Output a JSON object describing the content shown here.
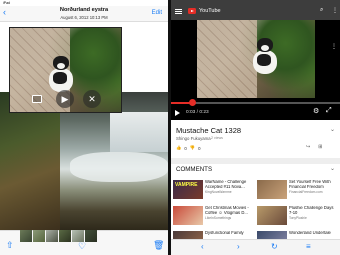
{
  "left": {
    "status": {
      "device": "iPad"
    },
    "navbar": {
      "back_icon": "chevron-left-icon",
      "title": "Norðurland eystra",
      "subtitle": "August 6, 2012  10:13 PM",
      "edit_label": "Edit"
    },
    "pip_controls": {
      "play_icon": "play-icon",
      "close_icon": "close-icon",
      "pip_icon": "picture-in-picture-icon"
    },
    "toolbar": {
      "share_icon": "share-icon",
      "heart_icon": "heart-icon",
      "trash_icon": "trash-icon"
    }
  },
  "right": {
    "app_title": "YouTube",
    "header_icons": [
      "menu-icon",
      "youtube-logo-icon",
      "search-icon",
      "more-vert-icon"
    ],
    "player": {
      "time": "0:03 / 0:23",
      "progress": 0.13
    },
    "video": {
      "title": "Mustache Cat 1328",
      "channel": "Shingo Fukuyama",
      "views": "2 views",
      "likes": "0",
      "dislikes": "0"
    },
    "comments_label": "COMMENTS",
    "related": [
      {
        "title": "WarName - Challenge",
        "line2": "Accepted #11 Nova...",
        "sub": "KingNovaWarnme",
        "thumb_text": "VAMPIRE"
      },
      {
        "title": "Set Yourself Free With",
        "line2": "Financial Freedom",
        "sub": "FinancialFreedom.com",
        "thumb_text": ""
      },
      {
        "title": "Get Christmas Movies -",
        "line2": "Coffee ☺ Vlogmas D...",
        "sub": "LikeInSomethings",
        "thumb_text": ""
      },
      {
        "title": "Plushie Challenge Days",
        "line2": "7-10",
        "sub": "TonyPlushie",
        "thumb_text": ""
      },
      {
        "title": "Dysfunctional Family",
        "line2": "",
        "sub": "",
        "thumb_text": ""
      },
      {
        "title": "Wonderland Undertale",
        "line2": "",
        "sub": "",
        "thumb_text": ""
      }
    ],
    "bottombar_icons": [
      "back-icon",
      "forward-icon",
      "reload-icon",
      "menu-lines-icon"
    ]
  }
}
